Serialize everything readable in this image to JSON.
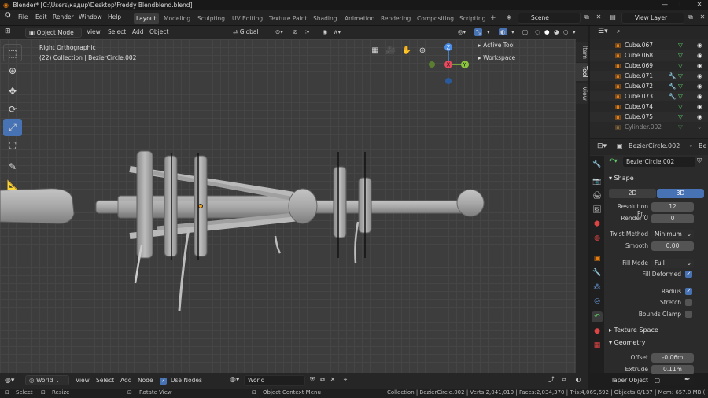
{
  "titlebar": {
    "title": "Blender* [C:\\Users\\кадир\\Desktop\\Freddy Blendblend.blend]",
    "minimize": "—",
    "maximize": "☐",
    "close": "✕"
  },
  "menu": [
    "File",
    "Edit",
    "Render",
    "Window",
    "Help"
  ],
  "workspaces": [
    "Layout",
    "Modeling",
    "Sculpting",
    "UV Editing",
    "Texture Paint",
    "Shading",
    "Animation",
    "Rendering",
    "Compositing",
    "Scripting"
  ],
  "add_workspace": "+",
  "scene": {
    "label": "Scene"
  },
  "view_layer": {
    "label": "View Layer"
  },
  "viewport_header": {
    "mode": "Object Mode",
    "view": "View",
    "select": "Select",
    "add": "Add",
    "object": "Object",
    "orientation": "Global"
  },
  "viewport": {
    "view_name": "Right Orthographic",
    "collection": "(22) Collection | BezierCircle.002"
  },
  "gizmo": {
    "z": "Z",
    "y": "Y",
    "x": "X"
  },
  "npanel": {
    "tabs": [
      "Item",
      "Tool",
      "View"
    ],
    "active_tool": "Active Tool",
    "workspace": "Workspace"
  },
  "outliner": {
    "rows": [
      {
        "name": "Cube.067",
        "dim": false,
        "modifier": false
      },
      {
        "name": "Cube.068",
        "dim": false,
        "modifier": false
      },
      {
        "name": "Cube.069",
        "dim": false,
        "modifier": false
      },
      {
        "name": "Cube.071",
        "dim": false,
        "modifier": true
      },
      {
        "name": "Cube.072",
        "dim": false,
        "modifier": true
      },
      {
        "name": "Cube.073",
        "dim": false,
        "modifier": true
      },
      {
        "name": "Cube.074",
        "dim": false,
        "modifier": false
      },
      {
        "name": "Cube.075",
        "dim": false,
        "modifier": false
      },
      {
        "name": "Cylinder.002",
        "dim": true,
        "modifier": false
      }
    ]
  },
  "properties": {
    "object_name": "BezierCircle.002",
    "data_name": "BezierCircle.002",
    "header_extra": "Be",
    "shape_section": "Shape",
    "dim_2d": "2D",
    "dim_3d": "3D",
    "resolution_label": "Resolution Pr...",
    "resolution_value": "12",
    "render_u_label": "Render U",
    "render_u_value": "0",
    "twist_label": "Twist Method",
    "twist_value": "Minimum",
    "smooth_label": "Smooth",
    "smooth_value": "0.00",
    "fill_mode_label": "Fill Mode",
    "fill_mode_value": "Full",
    "fill_deformed_label": "Fill Deformed",
    "radius_label": "Radius",
    "stretch_label": "Stretch",
    "bounds_clamp_label": "Bounds Clamp",
    "texture_space_section": "Texture Space",
    "geometry_section": "Geometry",
    "offset_label": "Offset",
    "offset_value": "-0.06m",
    "extrude_label": "Extrude",
    "extrude_value": "0.11m",
    "taper_label": "Taper Object"
  },
  "node_header": {
    "world_type": "World",
    "view": "View",
    "select": "Select",
    "add": "Add",
    "node": "Node",
    "use_nodes": "Use Nodes",
    "world_name": "World"
  },
  "status": {
    "select": "Select",
    "resize": "Resize",
    "rotate_view": "Rotate View",
    "context_menu": "Object Context Menu",
    "stats": "Collection | BezierCircle.002 | Verts:2,041,019 | Faces:2,034,370 | Tris:4,069,692 | Objects:0/137 | Mem: 657.0 MB (1.5 M"
  },
  "colors": {
    "accent": "#4772b3",
    "mesh_green": "#5fd16c",
    "x_axis": "#e84a5f",
    "y_axis": "#8ac43f",
    "z_axis": "#4a8ee8"
  }
}
